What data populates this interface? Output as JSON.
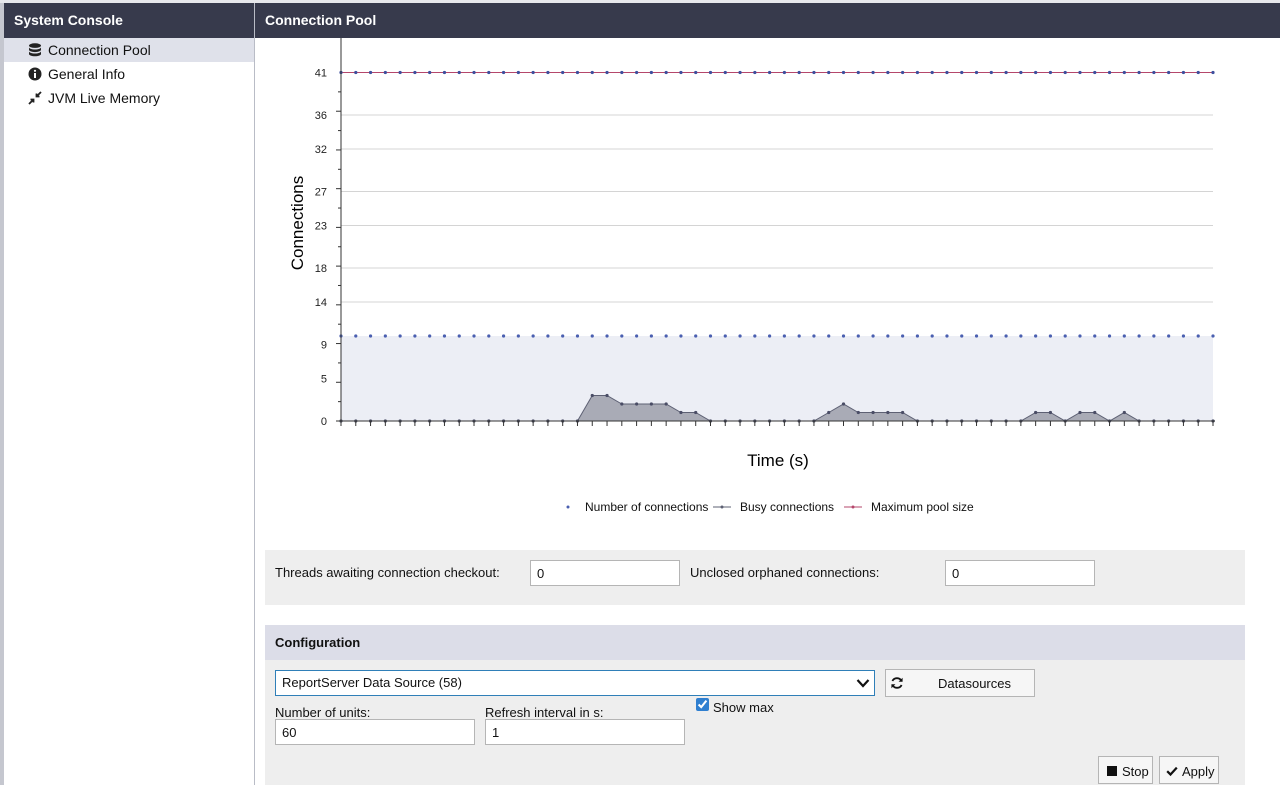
{
  "sidebar": {
    "title": "System Console",
    "items": [
      {
        "label": "Connection Pool",
        "icon": "database-icon",
        "active": true
      },
      {
        "label": "General Info",
        "icon": "info-icon",
        "active": false
      },
      {
        "label": "JVM Live Memory",
        "icon": "compress-icon",
        "active": false
      }
    ]
  },
  "main": {
    "title": "Connection Pool"
  },
  "chart_data": {
    "type": "line",
    "xlabel": "Time (s)",
    "ylabel": "Connections",
    "yticks": [
      0,
      5,
      9,
      14,
      18,
      23,
      27,
      32,
      36,
      41
    ],
    "ylim": [
      0,
      41
    ],
    "x_count": 60,
    "grid": true,
    "legend_position": "bottom",
    "series": [
      {
        "name": "Number of connections",
        "color": "#4a5fb0",
        "values": [
          10,
          10,
          10,
          10,
          10,
          10,
          10,
          10,
          10,
          10,
          10,
          10,
          10,
          10,
          10,
          10,
          10,
          10,
          10,
          10,
          10,
          10,
          10,
          10,
          10,
          10,
          10,
          10,
          10,
          10,
          10,
          10,
          10,
          10,
          10,
          10,
          10,
          10,
          10,
          10,
          10,
          10,
          10,
          10,
          10,
          10,
          10,
          10,
          10,
          10,
          10,
          10,
          10,
          10,
          10,
          10,
          10,
          10,
          10,
          10
        ]
      },
      {
        "name": "Busy connections",
        "color": "#5d6073",
        "values": [
          0,
          0,
          0,
          0,
          0,
          0,
          0,
          0,
          0,
          0,
          0,
          0,
          0,
          0,
          0,
          0,
          0,
          3,
          3,
          2,
          2,
          2,
          2,
          1,
          1,
          0,
          0,
          0,
          0,
          0,
          0,
          0,
          0,
          1,
          2,
          1,
          1,
          1,
          1,
          0,
          0,
          0,
          0,
          0,
          0,
          0,
          0,
          1,
          1,
          0,
          1,
          1,
          0,
          1,
          0,
          0,
          0,
          0,
          0,
          0
        ]
      },
      {
        "name": "Maximum pool size",
        "color": "#b5476b",
        "values": [
          41,
          41,
          41,
          41,
          41,
          41,
          41,
          41,
          41,
          41,
          41,
          41,
          41,
          41,
          41,
          41,
          41,
          41,
          41,
          41,
          41,
          41,
          41,
          41,
          41,
          41,
          41,
          41,
          41,
          41,
          41,
          41,
          41,
          41,
          41,
          41,
          41,
          41,
          41,
          41,
          41,
          41,
          41,
          41,
          41,
          41,
          41,
          41,
          41,
          41,
          41,
          41,
          41,
          41,
          41,
          41,
          41,
          41,
          41,
          41
        ]
      }
    ]
  },
  "stats": {
    "threads_label": "Threads awaiting connection checkout:",
    "threads_value": "0",
    "orphaned_label": "Unclosed orphaned connections:",
    "orphaned_value": "0"
  },
  "config": {
    "title": "Configuration",
    "datasource_selected": "ReportServer Data Source (58)",
    "datasources_button": "Datasources",
    "show_max_label": "Show max",
    "show_max_checked": true,
    "units_label": "Number of units:",
    "units_value": "60",
    "refresh_label": "Refresh interval in s:",
    "refresh_value": "1",
    "stop_button": "Stop",
    "apply_button": "Apply"
  }
}
